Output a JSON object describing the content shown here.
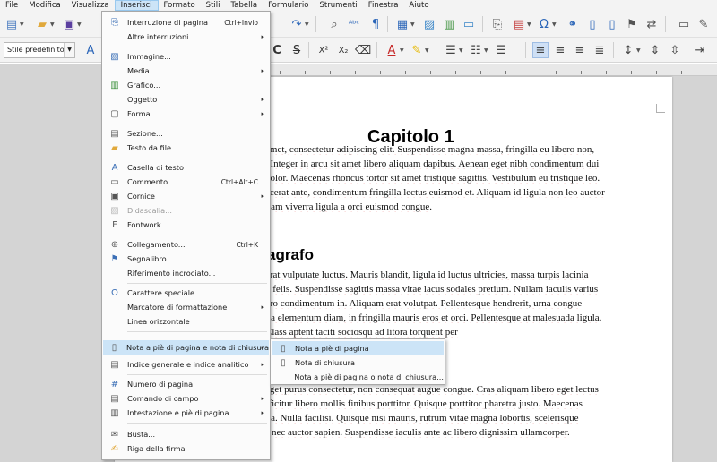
{
  "menubar": {
    "items": [
      {
        "label": "File"
      },
      {
        "label": "Modifica"
      },
      {
        "label": "Visualizza"
      },
      {
        "label": "Inserisci"
      },
      {
        "label": "Formato"
      },
      {
        "label": "Stili"
      },
      {
        "label": "Tabella"
      },
      {
        "label": "Formulario"
      },
      {
        "label": "Strumenti"
      },
      {
        "label": "Finestra"
      },
      {
        "label": "Aiuto"
      }
    ]
  },
  "toolbar": {
    "style_value": "Stile predefinito",
    "superscript": "X²",
    "subscript": "X₂",
    "strikethrough": "S",
    "shadow": "C",
    "font_color": "A",
    "omega": "Ω"
  },
  "insert_menu": {
    "items": [
      {
        "label": "Interruzione di pagina",
        "shortcut": "Ctrl+Invio",
        "icon": "page-break-icon"
      },
      {
        "label": "Altre interruzioni",
        "submenu": "▸",
        "icon": ""
      },
      {
        "label": "Immagine...",
        "icon": "image-icon"
      },
      {
        "label": "Media",
        "submenu": "▸",
        "icon": ""
      },
      {
        "label": "Grafico...",
        "icon": "chart-icon"
      },
      {
        "label": "Oggetto",
        "submenu": "▸",
        "icon": ""
      },
      {
        "label": "Forma",
        "submenu": "▸",
        "icon": "shape-icon"
      },
      {
        "label": "Sezione...",
        "icon": "section-icon"
      },
      {
        "label": "Testo da file...",
        "icon": "folder-icon"
      },
      {
        "label": "Casella di testo",
        "icon": "textbox-icon"
      },
      {
        "label": "Commento",
        "shortcut": "Ctrl+Alt+C",
        "icon": "comment-icon"
      },
      {
        "label": "Cornice",
        "submenu": "▸",
        "icon": "frame-icon"
      },
      {
        "label": "Didascalia...",
        "icon": "caption-icon",
        "disabled": true
      },
      {
        "label": "Fontwork...",
        "icon": "fontwork-icon"
      },
      {
        "label": "Collegamento...",
        "shortcut": "Ctrl+K",
        "icon": "hyperlink-icon"
      },
      {
        "label": "Segnalibro...",
        "icon": "bookmark-icon"
      },
      {
        "label": "Riferimento incrociato...",
        "icon": "cross-reference-icon"
      },
      {
        "label": "Carattere speciale...",
        "icon": "omega-icon"
      },
      {
        "label": "Marcatore di formattazione",
        "submenu": "▸",
        "icon": ""
      },
      {
        "label": "Linea orizzontale",
        "icon": ""
      },
      {
        "label": "Nota a piè di pagina e nota di chiusura",
        "submenu": "▸",
        "icon": "footnote-icon"
      },
      {
        "label": "Indice generale e indice analitico",
        "submenu": "▸",
        "icon": "index-icon"
      },
      {
        "label": "Numero di pagina",
        "icon": "page-number-icon"
      },
      {
        "label": "Comando di campo",
        "submenu": "▸",
        "icon": "field-icon"
      },
      {
        "label": "Intestazione e piè di pagina",
        "submenu": "▸",
        "icon": "header-footer-icon"
      },
      {
        "label": "Busta...",
        "icon": "envelope-icon"
      },
      {
        "label": "Riga della firma",
        "icon": "signature-line-icon"
      }
    ]
  },
  "footnote_submenu": {
    "items": [
      {
        "label": "Nota a piè di pagina",
        "icon": "footnote-icon"
      },
      {
        "label": "Nota di chiusura",
        "icon": "endnote-icon"
      },
      {
        "label": "Nota a piè di pagina o nota di chiusura...",
        "icon": ""
      }
    ]
  },
  "document": {
    "heading1": "Capitolo 1",
    "heading2": "agrafo",
    "para1": [
      "amet, consectetur adipiscing elit. Suspendisse magna massa, fringilla eu libero non,",
      ". Integer in arcu sit amet libero aliquam dapibus. Aenean eget nibh condimentum dui",
      "dolor. Maecenas rhoncus tortor sit amet tristique sagittis. Vestibulum eu tristique leo.",
      "acerat ante, condimentum fringilla lectus euismod et. Aliquam id ligula non leo auctor",
      "llam viverra ligula a orci euismod congue."
    ],
    "para2": [
      "erat vulputate luctus. Mauris blandit, ligula id luctus ultricies, massa turpis lacinia",
      "n felis. Suspendisse sagittis massa vitae lacus sodales pretium. Nullam iaculis varius",
      "ero condimentum in. Aliquam erat volutpat. Pellentesque hendrerit, urna congue",
      "lla elementum diam, in fringilla mauris eros et orci. Pellentesque at malesuada ligula.",
      "                                                  Class aptent taciti sociosqu ad litora torquent per",
      "                                                  leo aliquet tempus quis id dui. Aliquam erat"
    ],
    "para3": [
      "eget purus consectetur, non consequat augue congue. Cras aliquam libero eget lectus",
      "fficitur libero mollis finibus porttitor. Quisque porttitor pharetra justo. Maecenas",
      "lla. Nulla facilisi. Quisque nisi mauris, rutrum vitae magna lobortis, scelerisque",
      "s nec auctor sapien. Suspendisse iaculis ante ac libero dignissim ullamcorper."
    ]
  },
  "colors": {
    "menu_highlight": "#cce4f7",
    "spell_underline": "#e04545",
    "chrome": "#f3f3f3"
  }
}
